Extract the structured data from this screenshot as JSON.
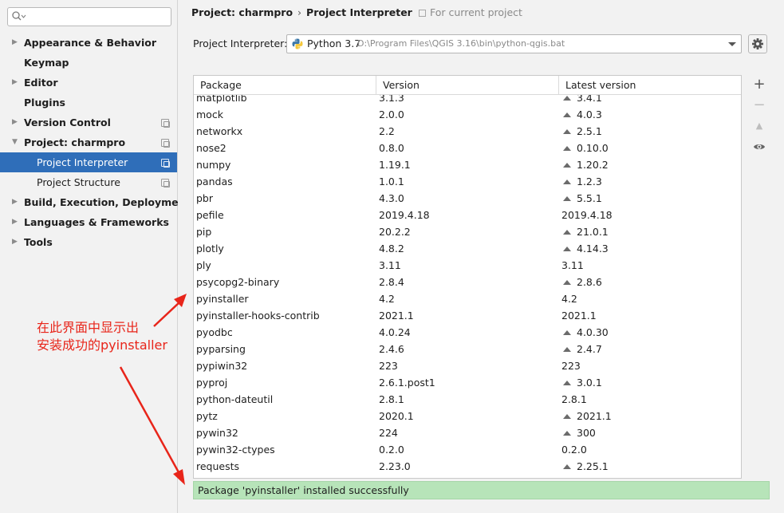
{
  "sidebar": {
    "search": {
      "value": "",
      "placeholder": ""
    },
    "items": [
      {
        "label": "Appearance & Behavior",
        "arrow": "▶",
        "level": 0,
        "has_icon": false
      },
      {
        "label": "Keymap",
        "arrow": "",
        "level": 0,
        "has_icon": false
      },
      {
        "label": "Editor",
        "arrow": "▶",
        "level": 0,
        "has_icon": false
      },
      {
        "label": "Plugins",
        "arrow": "",
        "level": 0,
        "has_icon": false
      },
      {
        "label": "Version Control",
        "arrow": "▶",
        "level": 0,
        "has_icon": true
      },
      {
        "label": "Project: charmpro",
        "arrow": "▼",
        "level": 0,
        "has_icon": true
      },
      {
        "label": "Project Interpreter",
        "arrow": "",
        "level": 1,
        "has_icon": true,
        "selected": true
      },
      {
        "label": "Project Structure",
        "arrow": "",
        "level": 1,
        "has_icon": true
      },
      {
        "label": "Build, Execution, Deployment",
        "arrow": "▶",
        "level": 0,
        "has_icon": false
      },
      {
        "label": "Languages & Frameworks",
        "arrow": "▶",
        "level": 0,
        "has_icon": false
      },
      {
        "label": "Tools",
        "arrow": "▶",
        "level": 0,
        "has_icon": false
      }
    ]
  },
  "header": {
    "crumb_project": "Project: charmpro",
    "crumb_separator": "›",
    "crumb_page": "Project Interpreter",
    "scope_hint": "For current project"
  },
  "interpreter": {
    "label": "Project Interpreter:",
    "name": "Python 3.7",
    "path": "D:\\Program Files\\QGIS 3.16\\bin\\python-qgis.bat"
  },
  "table": {
    "columns": [
      "Package",
      "Version",
      "Latest version"
    ],
    "rows": [
      {
        "package": "matplotlib",
        "version": "3.1.3",
        "latest": "3.4.1",
        "upgrade": true
      },
      {
        "package": "mock",
        "version": "2.0.0",
        "latest": "4.0.3",
        "upgrade": true
      },
      {
        "package": "networkx",
        "version": "2.2",
        "latest": "2.5.1",
        "upgrade": true
      },
      {
        "package": "nose2",
        "version": "0.8.0",
        "latest": "0.10.0",
        "upgrade": true
      },
      {
        "package": "numpy",
        "version": "1.19.1",
        "latest": "1.20.2",
        "upgrade": true
      },
      {
        "package": "pandas",
        "version": "1.0.1",
        "latest": "1.2.3",
        "upgrade": true
      },
      {
        "package": "pbr",
        "version": "4.3.0",
        "latest": "5.5.1",
        "upgrade": true
      },
      {
        "package": "pefile",
        "version": "2019.4.18",
        "latest": "2019.4.18",
        "upgrade": false
      },
      {
        "package": "pip",
        "version": "20.2.2",
        "latest": "21.0.1",
        "upgrade": true
      },
      {
        "package": "plotly",
        "version": "4.8.2",
        "latest": "4.14.3",
        "upgrade": true
      },
      {
        "package": "ply",
        "version": "3.11",
        "latest": "3.11",
        "upgrade": false
      },
      {
        "package": "psycopg2-binary",
        "version": "2.8.4",
        "latest": "2.8.6",
        "upgrade": true
      },
      {
        "package": "pyinstaller",
        "version": "4.2",
        "latest": "4.2",
        "upgrade": false
      },
      {
        "package": "pyinstaller-hooks-contrib",
        "version": "2021.1",
        "latest": "2021.1",
        "upgrade": false
      },
      {
        "package": "pyodbc",
        "version": "4.0.24",
        "latest": "4.0.30",
        "upgrade": true
      },
      {
        "package": "pyparsing",
        "version": "2.4.6",
        "latest": "2.4.7",
        "upgrade": true
      },
      {
        "package": "pypiwin32",
        "version": "223",
        "latest": "223",
        "upgrade": false
      },
      {
        "package": "pyproj",
        "version": "2.6.1.post1",
        "latest": "3.0.1",
        "upgrade": true
      },
      {
        "package": "python-dateutil",
        "version": "2.8.1",
        "latest": "2.8.1",
        "upgrade": false
      },
      {
        "package": "pytz",
        "version": "2020.1",
        "latest": "2021.1",
        "upgrade": true
      },
      {
        "package": "pywin32",
        "version": "224",
        "latest": "300",
        "upgrade": true
      },
      {
        "package": "pywin32-ctypes",
        "version": "0.2.0",
        "latest": "0.2.0",
        "upgrade": false
      },
      {
        "package": "requests",
        "version": "2.23.0",
        "latest": "2.25.1",
        "upgrade": true
      }
    ]
  },
  "tools": {
    "add": "+",
    "remove": "−",
    "upgrade": "▲",
    "show": "eye-icon"
  },
  "status": {
    "message": "Package 'pyinstaller' installed successfully"
  },
  "annotation": {
    "line1": "在此界面中显示出",
    "line2": "安装成功的pyinstaller"
  },
  "colors": {
    "selection": "#2f6eb9",
    "status_bg": "#b7e4b9",
    "annotation": "#e8251a"
  }
}
